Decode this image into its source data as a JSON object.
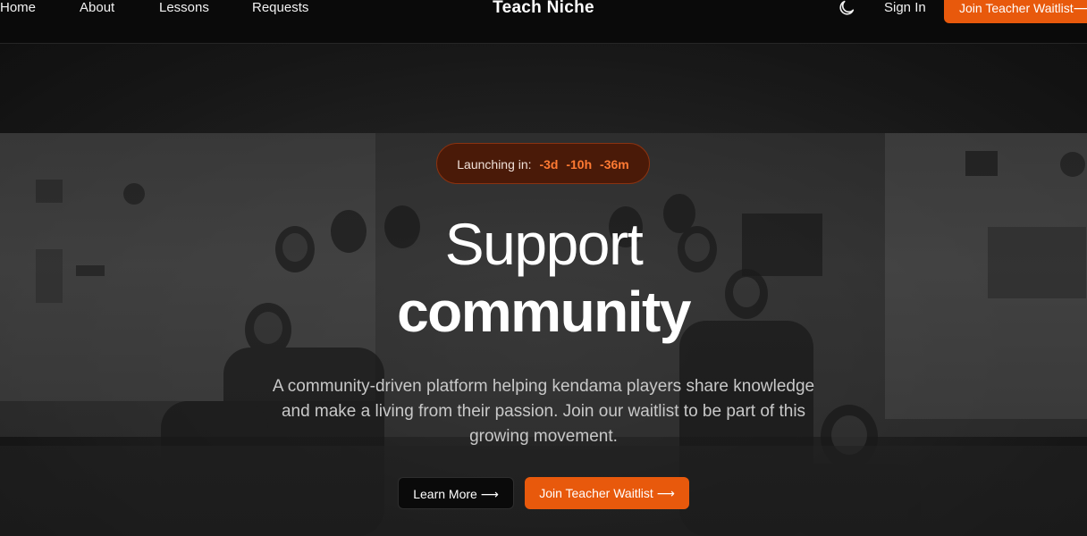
{
  "nav": {
    "links": [
      {
        "label": "Home"
      },
      {
        "label": "About"
      },
      {
        "label": "Lessons"
      },
      {
        "label": "Requests"
      }
    ],
    "brand": "Teach Niche",
    "theme_icon": "moon-icon",
    "sign_in": "Sign In",
    "cta_label": "Join Teacher Waitlist",
    "cta_arrow": "⟶"
  },
  "hero": {
    "countdown": {
      "label": "Launching in:",
      "days": "-3d",
      "hours": "-10h",
      "minutes": "-36m"
    },
    "headline_line1": "Support",
    "headline_line2": "community",
    "subtitle": "A community-driven platform helping kendama players share knowledge and make a living from their passion. Join our waitlist to be part of this growing movement.",
    "learn_more_label": "Learn More",
    "join_label": "Join Teacher Waitlist",
    "arrow": "⟶",
    "background_image": "group-photo-kendama-players"
  },
  "colors": {
    "accent": "#e8590c",
    "countdown_bg": "#4a1a08",
    "countdown_value": "#ff7a33",
    "nav_bg": "#0a0a0a"
  }
}
